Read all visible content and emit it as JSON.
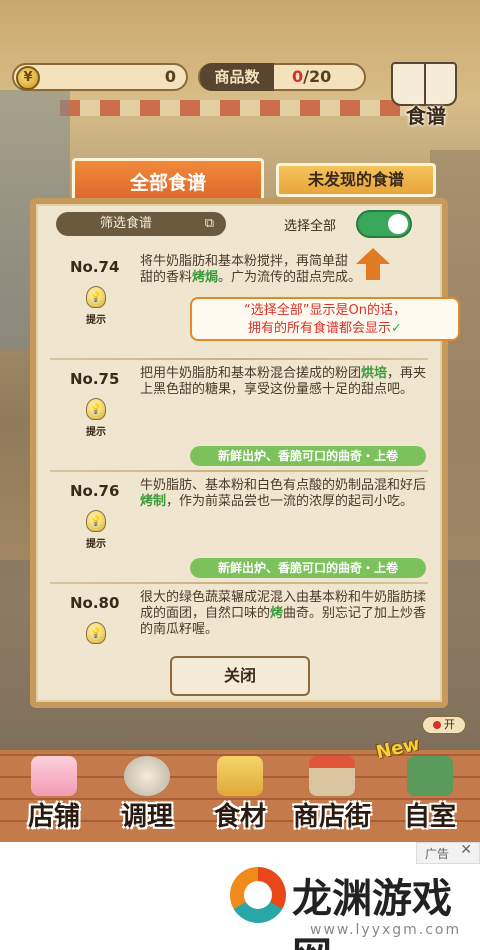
{
  "top": {
    "coin_value": "0",
    "coin_symbol": "¥",
    "goods_label": "商品数",
    "goods_current": "0",
    "goods_total": "/20",
    "recipe_label": "食谱"
  },
  "tabs": [
    {
      "label": "全部食谱"
    },
    {
      "label": "未发现的食谱"
    }
  ],
  "panel": {
    "filter_label": "筛选食谱",
    "select_all_label": "选择全部",
    "select_all_on": true
  },
  "tip": {
    "line1": "“选择全部”显示是On的话，",
    "line2": "拥有的所有食谱都会显示"
  },
  "recipes": [
    {
      "no": "No.74",
      "hint": "提示",
      "desc_pre": "将牛奶脂肪和基本粉搅拌，再简单",
      "desc_mid": "甜",
      "desc_line2": "甜的香料",
      "desc_green": "烤焗",
      "desc_post": "。广为流传的甜点完成。",
      "tag": ""
    },
    {
      "no": "No.75",
      "hint": "提示",
      "desc_pre": "把用牛奶脂肪和基本粉混合搓成的粉团",
      "desc_green": "烘培",
      "desc_post": "，再夹上黑色甜的糖果，享受这份量感十足的甜点吧。",
      "tag": "新鲜出炉、香脆可口的曲奇・上卷"
    },
    {
      "no": "No.76",
      "hint": "提示",
      "desc_pre": "牛奶脂肪、基本粉和白色有点酸的奶制品混和好后",
      "desc_green": "烤制",
      "desc_post": "，作为前菜品尝也一流的浓厚的起司小吃。",
      "tag": "新鲜出炉、香脆可口的曲奇・上卷"
    },
    {
      "no": "No.80",
      "hint": "",
      "desc_pre": "很大的绿色蔬菜辗成泥混入由基本粉和牛奶脂肪揉成的面团，自然口味的",
      "desc_green": "烤",
      "desc_post": "曲奇。别忘记了加上炒香的南瓜籽喔。",
      "tag": ""
    }
  ],
  "close_label": "关闭",
  "open_label": "开",
  "nav": [
    {
      "label": "店铺",
      "icon": "cake-icon"
    },
    {
      "label": "调理",
      "icon": "mixing-bowl-icon"
    },
    {
      "label": "食材",
      "icon": "flour-sack-icon"
    },
    {
      "label": "商店街",
      "icon": "shop-street-icon"
    },
    {
      "label": "自室",
      "icon": "staff-room-icon"
    }
  ],
  "new_badge": "New",
  "ad": {
    "label": "广告",
    "close": "✕",
    "brand": "龙渊游戏网",
    "url": "www.lyyxgm.com"
  },
  "colors": {
    "accent_orange": "#d9622a",
    "toggle_green": "#3aa85a",
    "highlight_green": "#3c9a3c",
    "alert_red": "#d9302a"
  }
}
